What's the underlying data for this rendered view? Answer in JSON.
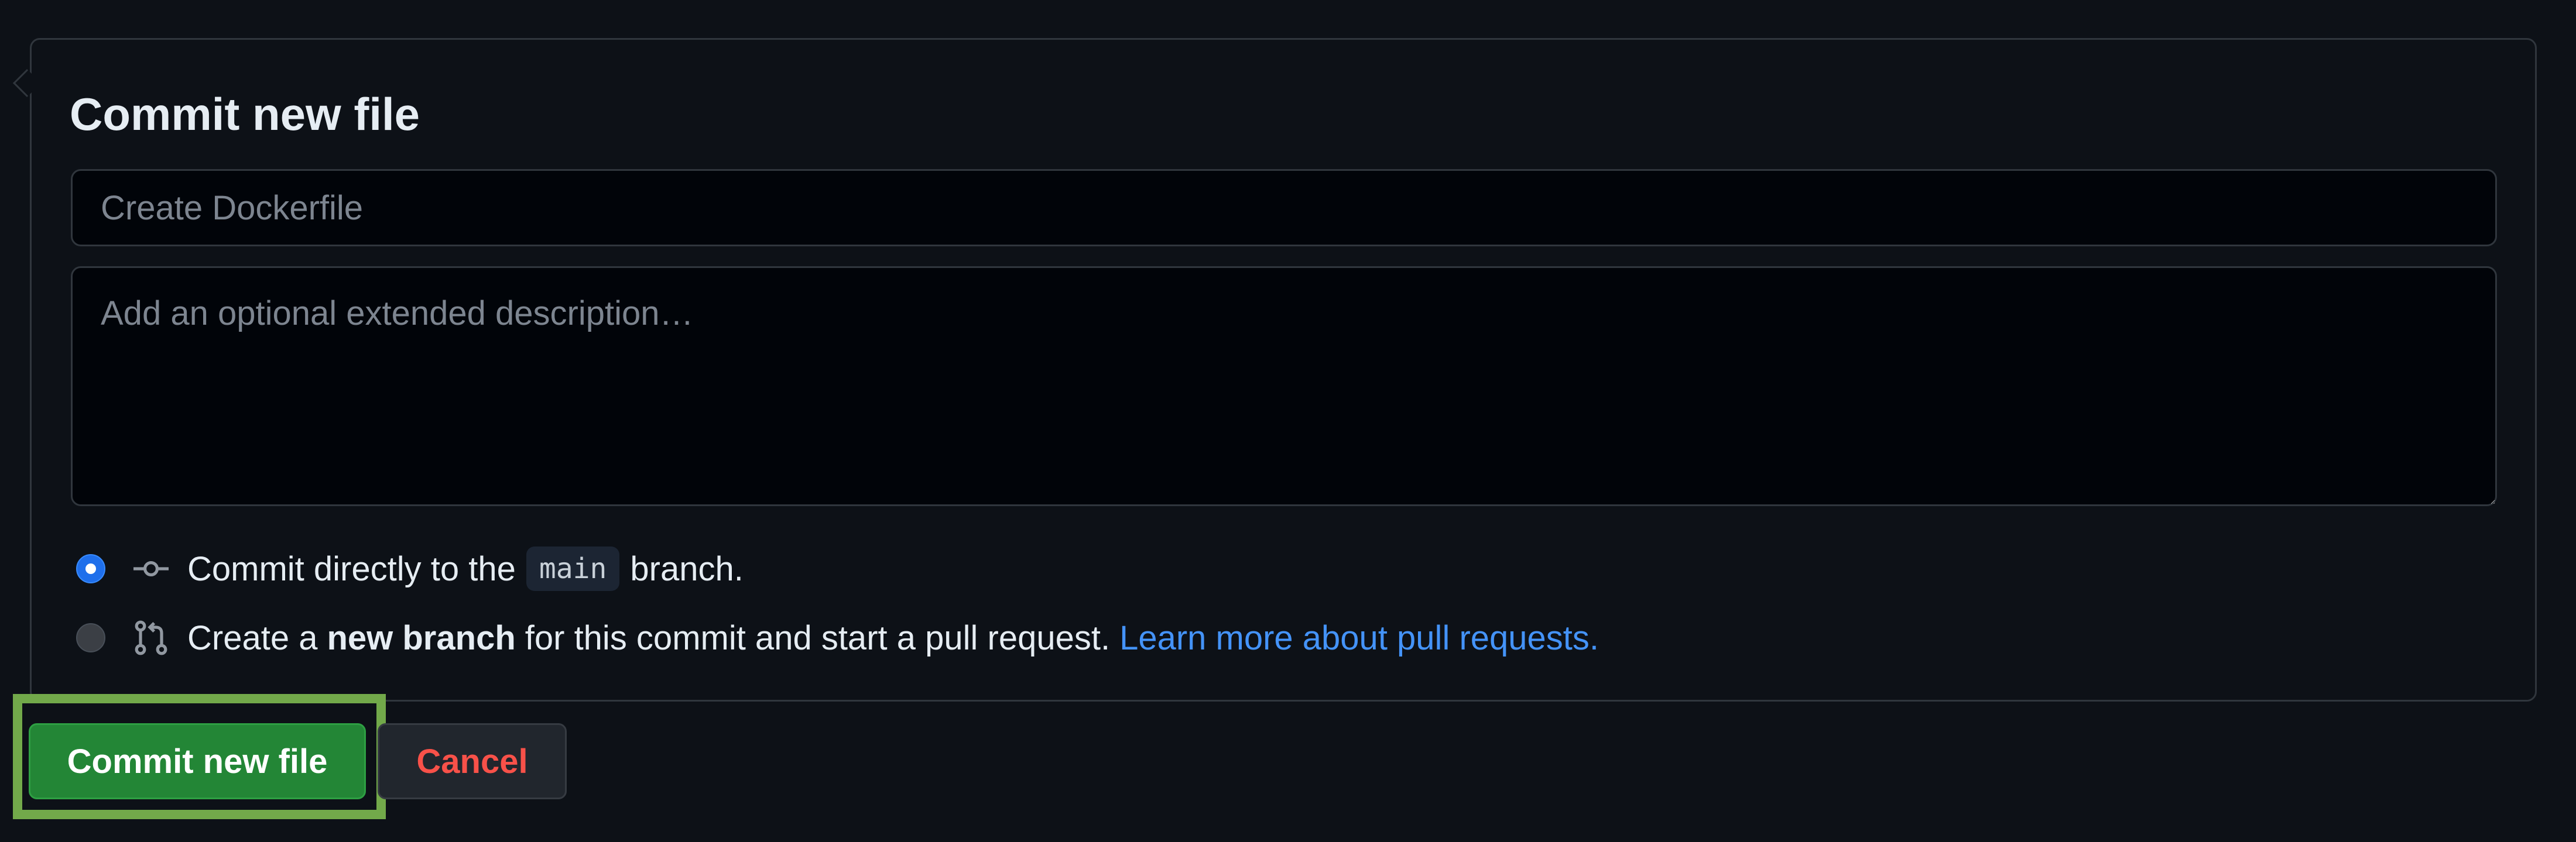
{
  "commit_form": {
    "title": "Commit new file",
    "summary_placeholder": "Create Dockerfile",
    "summary_value": "",
    "description_placeholder": "Add an optional extended description…",
    "description_value": "",
    "options": {
      "direct": {
        "selected": true,
        "icon": "git-commit-icon",
        "text_before": "Commit directly to the",
        "branch_name": "main",
        "text_after": "branch."
      },
      "new_branch": {
        "selected": false,
        "icon": "git-pull-request-icon",
        "text_before": "Create a",
        "text_bold": "new branch",
        "text_after": "for this commit and start a pull request.",
        "link_text": "Learn more about pull requests."
      }
    },
    "commit_button_label": "Commit new file",
    "cancel_button_label": "Cancel"
  },
  "colors": {
    "background": "#0d1117",
    "input_background": "#010409",
    "border": "#30363d",
    "primary_button": "#238636",
    "danger_text": "#f85149",
    "link": "#4493f8",
    "highlight": "#72a94a"
  }
}
